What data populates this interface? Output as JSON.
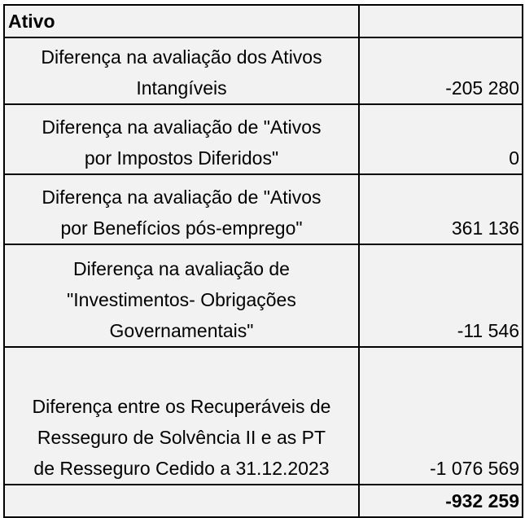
{
  "table": {
    "header": "Ativo",
    "rows": [
      {
        "label_lines": [
          "Diferença na avaliação dos Ativos",
          "Intangíveis"
        ],
        "value": "-205 280"
      },
      {
        "label_lines": [
          "Diferença na avaliação de \"Ativos",
          "por Impostos Diferidos\""
        ],
        "value": "0"
      },
      {
        "label_lines": [
          "Diferença na avaliação de \"Ativos",
          "por Benefícios pós-emprego\""
        ],
        "value": "361 136"
      },
      {
        "label_lines": [
          "Diferença na avaliação de",
          "\"Investimentos- Obrigações",
          "Governamentais\""
        ],
        "value": "-11 546"
      },
      {
        "label_lines": [
          "Diferença entre os Recuperáveis de",
          "Resseguro de Solvência II e as PT",
          "de Resseguro Cedido a 31.12.2023"
        ],
        "value": "-1 076 569"
      }
    ],
    "total": "-932 259"
  }
}
